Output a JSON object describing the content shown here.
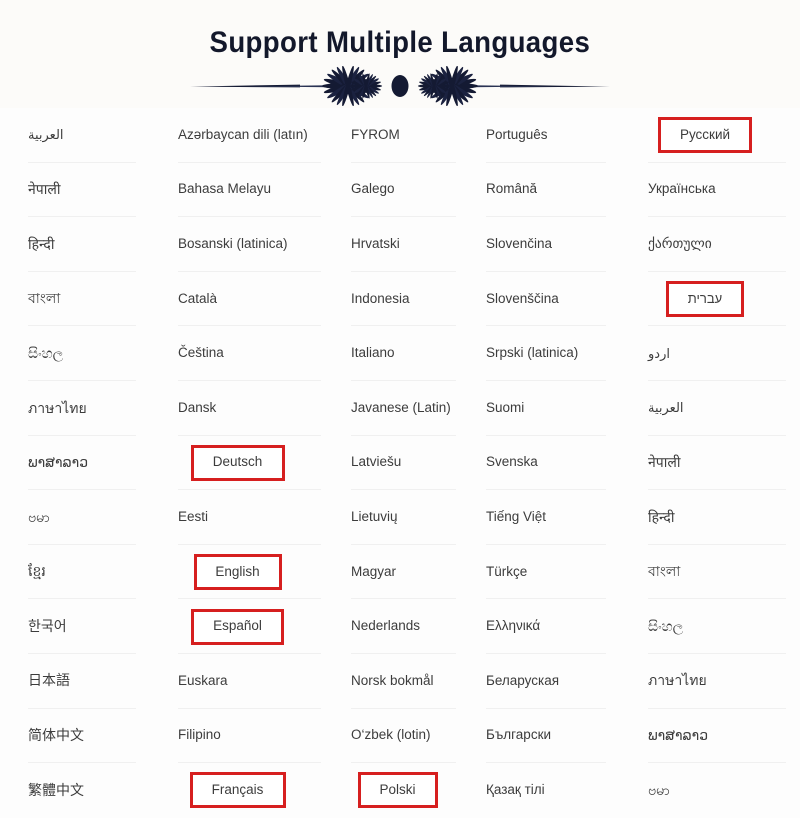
{
  "header": {
    "title": "Support Multiple Languages",
    "ornament": "fan-divider-ornament",
    "title_color": "#13182b",
    "background": "#fcfbf9"
  },
  "theme": {
    "page_background": "#fdfdfd",
    "text_color": "#3c3c3c",
    "separator_color": "#f0f0f0",
    "highlight_border": "#d61f1f",
    "highlight_fill": "#ffffff"
  },
  "columns": [
    {
      "index": 1,
      "items": [
        {
          "label": "العربية",
          "script": "rtl",
          "highlighted": false
        },
        {
          "label": "नेपाली",
          "script": "indic",
          "highlighted": false
        },
        {
          "label": "हिन्दी",
          "script": "indic",
          "highlighted": false
        },
        {
          "label": "বাংলা",
          "script": "indic",
          "highlighted": false
        },
        {
          "label": "සිංහල",
          "script": "indic",
          "highlighted": false
        },
        {
          "label": "ภาษาไทย",
          "script": "indic",
          "highlighted": false
        },
        {
          "label": "ພາສາລາວ",
          "script": "indic",
          "highlighted": false
        },
        {
          "label": "ဗမာ",
          "script": "indic",
          "highlighted": false
        },
        {
          "label": "ខ្មែរ",
          "script": "indic",
          "highlighted": false
        },
        {
          "label": "한국어",
          "script": "cjk",
          "highlighted": false
        },
        {
          "label": "日本語",
          "script": "cjk",
          "highlighted": false
        },
        {
          "label": "简体中文",
          "script": "cjk",
          "highlighted": false
        },
        {
          "label": "繁體中文",
          "script": "cjk",
          "highlighted": false
        }
      ]
    },
    {
      "index": 2,
      "items": [
        {
          "label": "Azərbaycan dili (latın)",
          "script": "latin",
          "highlighted": false
        },
        {
          "label": "Bahasa Melayu",
          "script": "latin",
          "highlighted": false
        },
        {
          "label": "Bosanski (latinica)",
          "script": "latin",
          "highlighted": false
        },
        {
          "label": "Català",
          "script": "latin",
          "highlighted": false
        },
        {
          "label": "Čeština",
          "script": "latin",
          "highlighted": false
        },
        {
          "label": "Dansk",
          "script": "latin",
          "highlighted": false
        },
        {
          "label": "Deutsch",
          "script": "latin",
          "highlighted": true
        },
        {
          "label": "Eesti",
          "script": "latin",
          "highlighted": false
        },
        {
          "label": "English",
          "script": "latin",
          "highlighted": true
        },
        {
          "label": "Español",
          "script": "latin",
          "highlighted": true
        },
        {
          "label": "Euskara",
          "script": "latin",
          "highlighted": false
        },
        {
          "label": "Filipino",
          "script": "latin",
          "highlighted": false
        },
        {
          "label": "Français",
          "script": "latin",
          "highlighted": true
        }
      ]
    },
    {
      "index": 3,
      "items": [
        {
          "label": "FYROM",
          "script": "latin",
          "highlighted": false
        },
        {
          "label": "Galego",
          "script": "latin",
          "highlighted": false
        },
        {
          "label": "Hrvatski",
          "script": "latin",
          "highlighted": false
        },
        {
          "label": "Indonesia",
          "script": "latin",
          "highlighted": false
        },
        {
          "label": "Italiano",
          "script": "latin",
          "highlighted": false
        },
        {
          "label": "Javanese (Latin)",
          "script": "latin",
          "highlighted": false
        },
        {
          "label": "Latviešu",
          "script": "latin",
          "highlighted": false
        },
        {
          "label": "Lietuvių",
          "script": "latin",
          "highlighted": false
        },
        {
          "label": "Magyar",
          "script": "latin",
          "highlighted": false
        },
        {
          "label": "Nederlands",
          "script": "latin",
          "highlighted": false
        },
        {
          "label": "Norsk bokmål",
          "script": "latin",
          "highlighted": false
        },
        {
          "label": "O‘zbek (lotin)",
          "script": "latin",
          "highlighted": false
        },
        {
          "label": "Polski",
          "script": "latin",
          "highlighted": true
        }
      ]
    },
    {
      "index": 4,
      "items": [
        {
          "label": "Português",
          "script": "latin",
          "highlighted": false
        },
        {
          "label": "Română",
          "script": "latin",
          "highlighted": false
        },
        {
          "label": "Slovenčina",
          "script": "latin",
          "highlighted": false
        },
        {
          "label": "Slovenščina",
          "script": "latin",
          "highlighted": false
        },
        {
          "label": "Srpski (latinica)",
          "script": "latin",
          "highlighted": false
        },
        {
          "label": "Suomi",
          "script": "latin",
          "highlighted": false
        },
        {
          "label": "Svenska",
          "script": "latin",
          "highlighted": false
        },
        {
          "label": "Tiếng Việt",
          "script": "latin",
          "highlighted": false
        },
        {
          "label": "Türkçe",
          "script": "latin",
          "highlighted": false
        },
        {
          "label": "Ελληνικά",
          "script": "greek",
          "highlighted": false
        },
        {
          "label": "Беларуская",
          "script": "cyrillic",
          "highlighted": false
        },
        {
          "label": "Български",
          "script": "cyrillic",
          "highlighted": false
        },
        {
          "label": "Қазақ тілі",
          "script": "cyrillic",
          "highlighted": false
        }
      ]
    },
    {
      "index": 5,
      "items": [
        {
          "label": "Русский",
          "script": "cyrillic",
          "highlighted": true
        },
        {
          "label": "Українська",
          "script": "cyrillic",
          "highlighted": false
        },
        {
          "label": "ქართული",
          "script": "georgian",
          "highlighted": false
        },
        {
          "label": "עברית",
          "script": "rtl",
          "highlighted": true
        },
        {
          "label": "اردو",
          "script": "rtl",
          "highlighted": false
        },
        {
          "label": "العربية",
          "script": "rtl",
          "highlighted": false
        },
        {
          "label": "नेपाली",
          "script": "indic",
          "highlighted": false
        },
        {
          "label": "हिन्दी",
          "script": "indic",
          "highlighted": false
        },
        {
          "label": "বাংলা",
          "script": "indic",
          "highlighted": false
        },
        {
          "label": "සිංහල",
          "script": "indic",
          "highlighted": false
        },
        {
          "label": "ภาษาไทย",
          "script": "indic",
          "highlighted": false
        },
        {
          "label": "ພາສາລາວ",
          "script": "indic",
          "highlighted": false
        },
        {
          "label": "ဗမာ",
          "script": "indic",
          "highlighted": false
        }
      ]
    }
  ]
}
